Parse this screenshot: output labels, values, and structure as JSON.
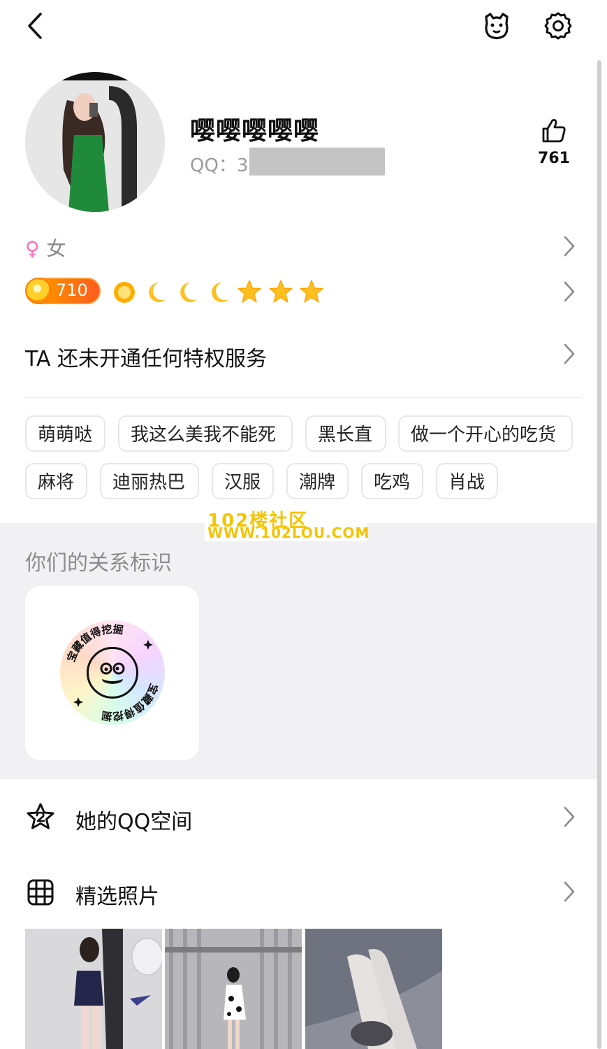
{
  "header": {
    "back_icon": "chevron-left-icon",
    "avatar_mascot_icon": "penguin-face-icon",
    "settings_icon": "gear-icon"
  },
  "profile": {
    "nickname": "嘤嘤嘤嘤嘤",
    "qq_label": "QQ：3",
    "like_count": "761"
  },
  "gender": {
    "symbol": "♀",
    "label": "女"
  },
  "level": {
    "value": "710",
    "icons": [
      "sun-icon",
      "moon-icon",
      "moon-icon",
      "moon-icon",
      "star-icon",
      "star-icon",
      "star-icon"
    ]
  },
  "privilege_text": "TA 还未开通任何特权服务",
  "tags": [
    "萌萌哒",
    "我这么美我不能死",
    "黑长直",
    "做一个开心的吃货",
    "麻将",
    "迪丽热巴",
    "汉服",
    "潮牌",
    "吃鸡",
    "肖战"
  ],
  "watermark": {
    "line1": "102楼社区",
    "line2": "WWW.102LOU.COM"
  },
  "relationship": {
    "title": "你们的关系标识",
    "badge_text": "宝藏值得挖掘"
  },
  "menu": {
    "qzone": {
      "label": "她的QQ空间",
      "icon": "star-2-icon"
    },
    "photos": {
      "label": "精选照片",
      "icon": "grid-icon"
    }
  },
  "colors": {
    "accent_pink": "#ff6fae",
    "watermark_yellow": "#f5c400",
    "level_orange": "#ff8a00",
    "section_grey": "#f1f1f3"
  }
}
